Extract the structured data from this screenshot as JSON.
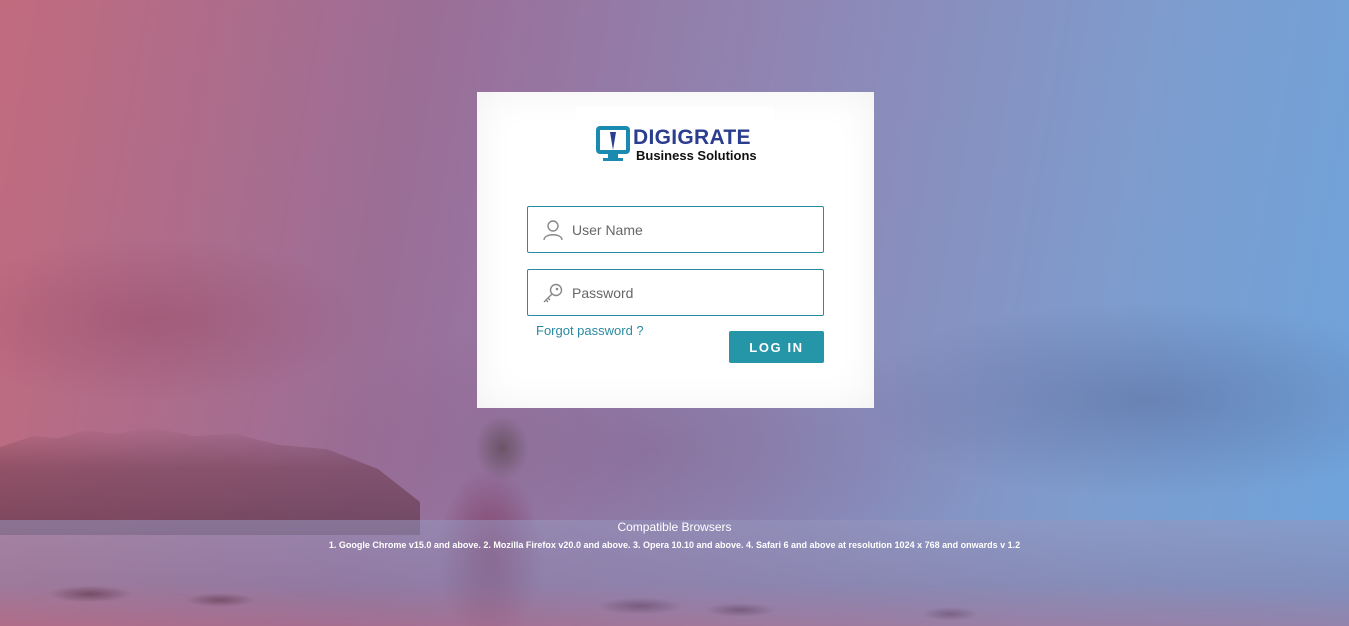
{
  "brand": {
    "title": "DIGIGRATE",
    "subtitle": "Business Solutions",
    "accent_color": "#2596a8",
    "logo_text_color": "#2a3d8f"
  },
  "login": {
    "username_placeholder": "User Name",
    "username_value": "",
    "username_icon": "user-icon",
    "password_placeholder": "Password",
    "password_value": "",
    "password_icon": "key-icon",
    "forgot_label": "Forgot password ?",
    "login_label": "LOG IN"
  },
  "footer": {
    "compat_title": "Compatible Browsers",
    "compat_list": "1. Google Chrome v15.0 and above. 2. Mozilla Firefox v20.0 and above. 3. Opera 10.10 and above. 4. Safari 6 and above at resolution 1024 x 768 and onwards v 1.2"
  }
}
